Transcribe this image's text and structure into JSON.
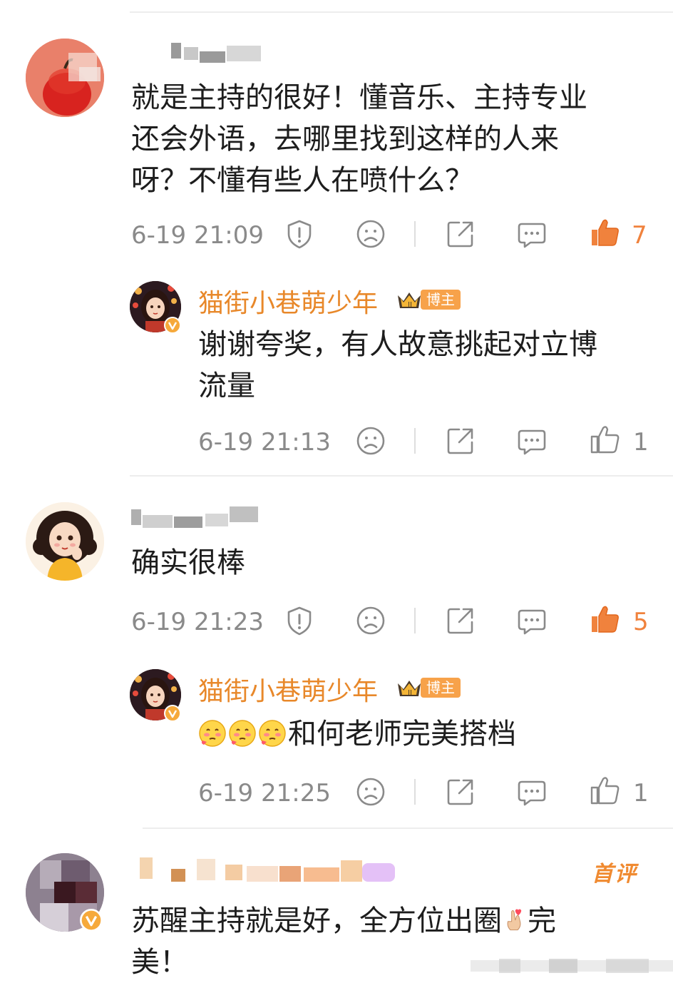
{
  "comments": [
    {
      "text": "就是主持的很好！懂音乐、主持专业还会外语，去哪里找到这样的人来呀？不懂有些人在喷什么？",
      "lines": [
        "就是主持的很好！懂音乐、主持专业",
        "还会外语，去哪里找到这样的人来",
        "呀？不懂有些人在喷什么？"
      ],
      "time": "6-19 21:09",
      "likes": "7",
      "reply": {
        "author": "猫街小巷萌少年",
        "badge": "博主",
        "lines": [
          "谢谢夸奖，有人故意挑起对立博",
          "流量"
        ],
        "time": "6-19 21:13",
        "likes": "1"
      }
    },
    {
      "text": "确实很棒",
      "time": "6-19 21:23",
      "likes": "5",
      "reply": {
        "author": "猫街小巷萌少年",
        "badge": "博主",
        "text": "和何老师完美搭档",
        "time": "6-19 21:25",
        "likes": "1"
      }
    },
    {
      "lines": [
        "苏醒主持就是好，全方位出圈",
        "完",
        "美！"
      ],
      "tag": "首评"
    }
  ],
  "icons": {
    "report": "report-icon",
    "dislike": "dislike-face-icon",
    "share": "share-icon",
    "comment": "comment-icon",
    "like": "thumbs-up-icon",
    "verified": "verified-v-icon",
    "crown": "crown-badge-icon",
    "blush_emoji": "blush-emoji-icon",
    "finger_heart": "finger-heart-emoji-icon"
  },
  "colors": {
    "accent": "#f0823d",
    "author": "#e8882a",
    "muted": "#8a8a8a",
    "badge": "#f7a24a"
  }
}
